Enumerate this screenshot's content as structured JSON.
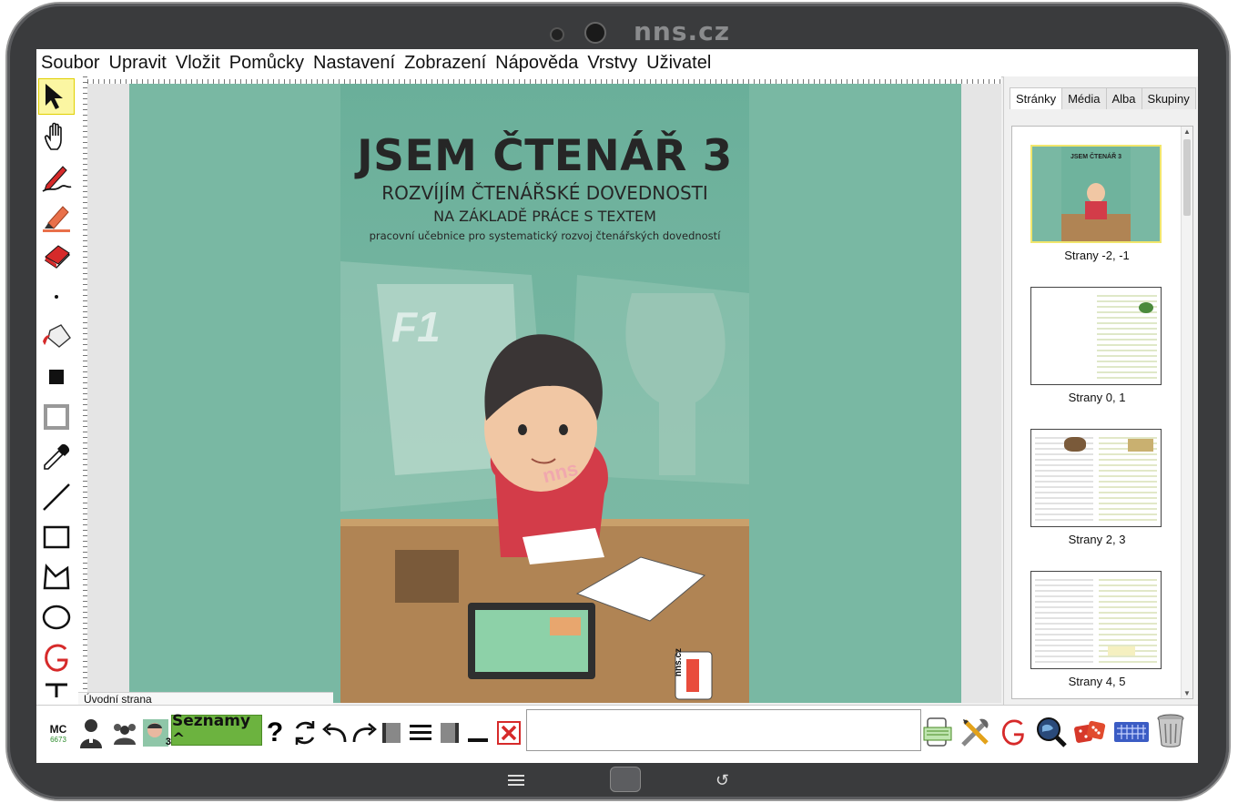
{
  "device": {
    "brand": "nns.cz"
  },
  "menu": [
    "Soubor",
    "Upravit",
    "Vložit",
    "Pomůcky",
    "Nastavení",
    "Zobrazení",
    "Nápověda",
    "Vrstvy",
    "Uživatel"
  ],
  "tools": [
    "pointer-icon",
    "hand-icon",
    "pen-icon",
    "highlighter-icon",
    "eraser-icon",
    "dot-icon",
    "fill-bucket-icon",
    "filled-square-icon",
    "border-square-icon",
    "eyedropper-icon",
    "line-icon",
    "rectangle-icon",
    "polygon-icon",
    "ellipse-icon",
    "geogebra-icon",
    "text-icon"
  ],
  "cover": {
    "title": "JSEM ČTENÁŘ 3",
    "subtitle1": "ROZVÍJÍM ČTENÁŘSKÉ DOVEDNOSTI",
    "subtitle2": "NA ZÁKLADĚ PRÁCE S TEXTEM",
    "subtitle3": "pracovní učebnice pro systematický rozvoj čtenářských dovedností",
    "shirt_text": "nns",
    "book_logo": "nns.cz",
    "poster_text": "F1"
  },
  "page_label": "Úvodní strana",
  "sidepanel": {
    "tabs": [
      "Stránky",
      "Média",
      "Alba",
      "Skupiny"
    ],
    "active_tab": "Stránky",
    "pages": [
      "Strany -2, -1",
      "Strany 0, 1",
      "Strany 2, 3",
      "Strany 4, 5"
    ],
    "thumb1_title": "JSEM ČTENÁŘ 3"
  },
  "bottombar": {
    "mc_label": "MC",
    "mc_number": "6673",
    "class_badge": "3",
    "seznamy_label": "Seznamy ^",
    "help_label": "?"
  },
  "colors": {
    "cover_bg": "#79b8a3",
    "accent_green": "#6cb33f",
    "selected_tool": "#fbf6a2"
  }
}
